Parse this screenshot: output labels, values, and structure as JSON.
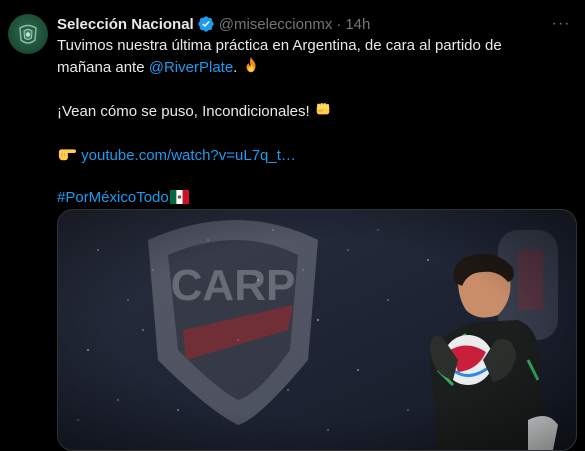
{
  "tweet": {
    "display_name": "Selección Nacional",
    "handle": "@miseleccionmx",
    "separator": "·",
    "time": "14h",
    "more_label": "···",
    "text": {
      "line1_a": "Tuvimos nuestra última práctica en Argentina, de cara al partido de",
      "line1_b": "mañana ante",
      "mention": "@RiverPlate",
      "line1_end": ".",
      "line2": "¡Vean cómo se puso, Incondicionales!",
      "link": "youtube.com/watch?v=uL7q_t…",
      "hashtag": "#PorMéxicoTodo"
    },
    "icons": {
      "verified": "verified-badge-icon",
      "fire": "fire-emoji-icon",
      "fist": "fist-emoji-icon",
      "pointing": "pointing-hand-emoji-icon",
      "flag": "mexico-flag-emoji-icon"
    },
    "media": {
      "description_icon": "goalkeeper-photo"
    },
    "colors": {
      "background": "#000000",
      "text": "#e7e9ea",
      "secondary": "#71767b",
      "link": "#1d9bf0",
      "verified": "#1d9bf0"
    }
  }
}
